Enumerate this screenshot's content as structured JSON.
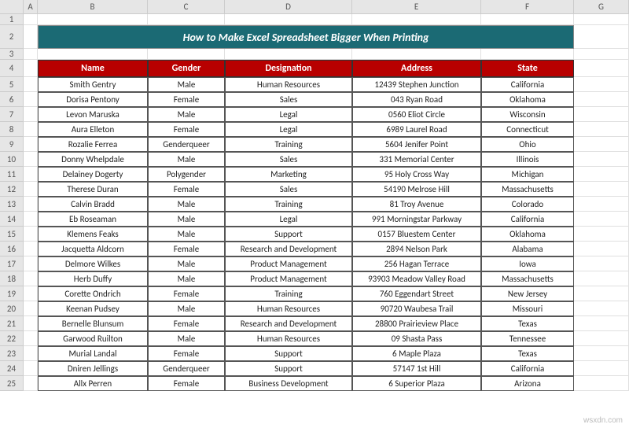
{
  "col_labels": [
    "A",
    "B",
    "C",
    "D",
    "E",
    "F",
    "G"
  ],
  "row_labels": [
    "1",
    "2",
    "3",
    "4",
    "5",
    "6",
    "7",
    "8",
    "9",
    "10",
    "11",
    "12",
    "13",
    "14",
    "15",
    "16",
    "17",
    "18",
    "19",
    "20",
    "21",
    "22",
    "23",
    "24",
    "25"
  ],
  "title": "How to Make Excel Spreadsheet Bigger When Printing",
  "headers": {
    "name": "Name",
    "gender": "Gender",
    "designation": "Designation",
    "address": "Address",
    "state": "State"
  },
  "rows": [
    {
      "name": "Smith Gentry",
      "gender": "Male",
      "designation": "Human Resources",
      "address": "12439 Stephen Junction",
      "state": "California"
    },
    {
      "name": "Dorisa Pentony",
      "gender": "Female",
      "designation": "Sales",
      "address": "043 Ryan Road",
      "state": "Oklahoma"
    },
    {
      "name": "Levon Maruska",
      "gender": "Male",
      "designation": "Legal",
      "address": "0560 Eliot Circle",
      "state": "Wisconsin"
    },
    {
      "name": "Aura Elleton",
      "gender": "Female",
      "designation": "Legal",
      "address": "6989 Laurel Road",
      "state": "Connecticut"
    },
    {
      "name": "Rozalie Ferrea",
      "gender": "Genderqueer",
      "designation": "Training",
      "address": "5604 Jenifer Point",
      "state": "Ohio"
    },
    {
      "name": "Donny Whelpdale",
      "gender": "Male",
      "designation": "Sales",
      "address": "331 Memorial Center",
      "state": "Illinois"
    },
    {
      "name": "Delainey Dogerty",
      "gender": "Polygender",
      "designation": "Marketing",
      "address": "95 Holy Cross Way",
      "state": "Michigan"
    },
    {
      "name": "Therese Duran",
      "gender": "Female",
      "designation": "Sales",
      "address": "54190 Melrose Hill",
      "state": "Massachusetts"
    },
    {
      "name": "Calvin Bradd",
      "gender": "Male",
      "designation": "Training",
      "address": "81 Troy Avenue",
      "state": "Colorado"
    },
    {
      "name": "Eb Roseaman",
      "gender": "Male",
      "designation": "Legal",
      "address": "991 Morningstar Parkway",
      "state": "California"
    },
    {
      "name": "Klemens Feaks",
      "gender": "Male",
      "designation": "Support",
      "address": "0157 Bluestem Center",
      "state": "Oklahoma"
    },
    {
      "name": "Jacquetta Aldcorn",
      "gender": "Female",
      "designation": "Research and Development",
      "address": "2894 Nelson Park",
      "state": "Alabama"
    },
    {
      "name": "Delmore Wilkes",
      "gender": "Male",
      "designation": "Product Management",
      "address": "256 Hagan Terrace",
      "state": "Iowa"
    },
    {
      "name": "Herb Duffy",
      "gender": "Male",
      "designation": "Product Management",
      "address": "93903 Meadow Valley Road",
      "state": "Massachusetts"
    },
    {
      "name": "Corette Ondrich",
      "gender": "Female",
      "designation": "Training",
      "address": "760 Eggendart Street",
      "state": "New Jersey"
    },
    {
      "name": "Keenan Pudsey",
      "gender": "Male",
      "designation": "Human Resources",
      "address": "90720 Waubesa Trail",
      "state": "Missouri"
    },
    {
      "name": "Bernelle Blunsum",
      "gender": "Female",
      "designation": "Research and Development",
      "address": "28800 Prairieview Place",
      "state": "Texas"
    },
    {
      "name": "Garwood Ruilton",
      "gender": "Male",
      "designation": "Human Resources",
      "address": "09 Shasta Pass",
      "state": "Tennessee"
    },
    {
      "name": "Murial Landal",
      "gender": "Female",
      "designation": "Support",
      "address": "6 Maple Plaza",
      "state": "Texas"
    },
    {
      "name": "Dniren Jellings",
      "gender": "Genderqueer",
      "designation": "Support",
      "address": "57147 1st Hill",
      "state": "California"
    },
    {
      "name": "Allx Perren",
      "gender": "Female",
      "designation": "Business Development",
      "address": "6 Superior Plaza",
      "state": "Arizona"
    }
  ],
  "watermark": "wsxdn.com",
  "chart_data": {
    "type": "table",
    "title": "How to Make Excel Spreadsheet Bigger When Printing",
    "columns": [
      "Name",
      "Gender",
      "Designation",
      "Address",
      "State"
    ],
    "rows": [
      [
        "Smith Gentry",
        "Male",
        "Human Resources",
        "12439 Stephen Junction",
        "California"
      ],
      [
        "Dorisa Pentony",
        "Female",
        "Sales",
        "043 Ryan Road",
        "Oklahoma"
      ],
      [
        "Levon Maruska",
        "Male",
        "Legal",
        "0560 Eliot Circle",
        "Wisconsin"
      ],
      [
        "Aura Elleton",
        "Female",
        "Legal",
        "6989 Laurel Road",
        "Connecticut"
      ],
      [
        "Rozalie Ferrea",
        "Genderqueer",
        "Training",
        "5604 Jenifer Point",
        "Ohio"
      ],
      [
        "Donny Whelpdale",
        "Male",
        "Sales",
        "331 Memorial Center",
        "Illinois"
      ],
      [
        "Delainey Dogerty",
        "Polygender",
        "Marketing",
        "95 Holy Cross Way",
        "Michigan"
      ],
      [
        "Therese Duran",
        "Female",
        "Sales",
        "54190 Melrose Hill",
        "Massachusetts"
      ],
      [
        "Calvin Bradd",
        "Male",
        "Training",
        "81 Troy Avenue",
        "Colorado"
      ],
      [
        "Eb Roseaman",
        "Male",
        "Legal",
        "991 Morningstar Parkway",
        "California"
      ],
      [
        "Klemens Feaks",
        "Male",
        "Support",
        "0157 Bluestem Center",
        "Oklahoma"
      ],
      [
        "Jacquetta Aldcorn",
        "Female",
        "Research and Development",
        "2894 Nelson Park",
        "Alabama"
      ],
      [
        "Delmore Wilkes",
        "Male",
        "Product Management",
        "256 Hagan Terrace",
        "Iowa"
      ],
      [
        "Herb Duffy",
        "Male",
        "Product Management",
        "93903 Meadow Valley Road",
        "Massachusetts"
      ],
      [
        "Corette Ondrich",
        "Female",
        "Training",
        "760 Eggendart Street",
        "New Jersey"
      ],
      [
        "Keenan Pudsey",
        "Male",
        "Human Resources",
        "90720 Waubesa Trail",
        "Missouri"
      ],
      [
        "Bernelle Blunsum",
        "Female",
        "Research and Development",
        "28800 Prairieview Place",
        "Texas"
      ],
      [
        "Garwood Ruilton",
        "Male",
        "Human Resources",
        "09 Shasta Pass",
        "Tennessee"
      ],
      [
        "Murial Landal",
        "Female",
        "Support",
        "6 Maple Plaza",
        "Texas"
      ],
      [
        "Dniren Jellings",
        "Genderqueer",
        "Support",
        "57147 1st Hill",
        "California"
      ],
      [
        "Allx Perren",
        "Female",
        "Business Development",
        "6 Superior Plaza",
        "Arizona"
      ]
    ]
  }
}
